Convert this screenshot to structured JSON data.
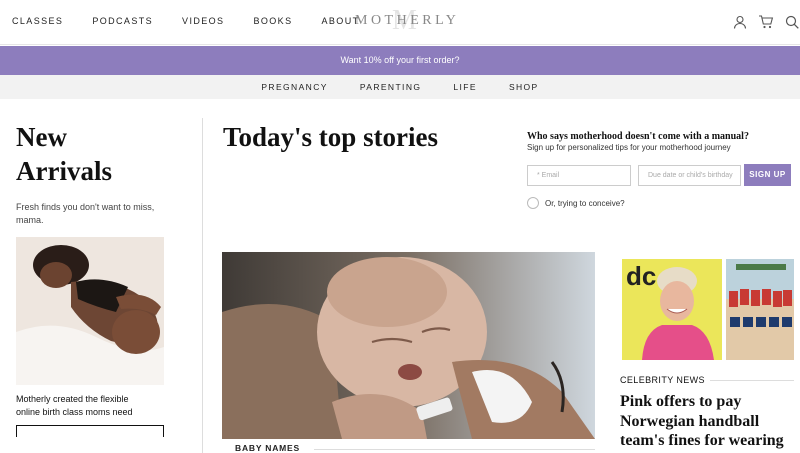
{
  "nav": {
    "links": [
      "CLASSES",
      "PODCASTS",
      "VIDEOS",
      "BOOKS",
      "ABOUT"
    ],
    "logo": "MOTHERLY",
    "logo_mark": "M",
    "icons": [
      "user-icon",
      "cart-icon",
      "search-icon"
    ]
  },
  "promo": {
    "text": "Want 10% off your first order?"
  },
  "subnav": {
    "items": [
      "PREGNANCY",
      "PARENTING",
      "LIFE",
      "SHOP"
    ]
  },
  "left": {
    "title": "New Arrivals",
    "subtitle": "Fresh finds you don't want to miss, mama.",
    "caption": "Motherly created the flexible online birth class moms need"
  },
  "center": {
    "title": "Today's top stories",
    "hero_tag": "BABY NAMES"
  },
  "signup": {
    "title": "Who says motherhood doesn't come with a manual?",
    "subtitle": "Sign up for personalized tips for your motherhood journey",
    "email_placeholder": "* Email",
    "date_placeholder": "Due date or child's birthday",
    "button": "SIGN UP",
    "radio_label": "Or, trying to conceive?"
  },
  "right": {
    "tag": "CELEBRITY NEWS",
    "headline": "Pink offers to pay Norwegian handball team's fines for wearing",
    "img1_logo": "dc"
  },
  "colors": {
    "accent": "#8d7dbd",
    "subnav_bg": "#f2f2f2"
  }
}
